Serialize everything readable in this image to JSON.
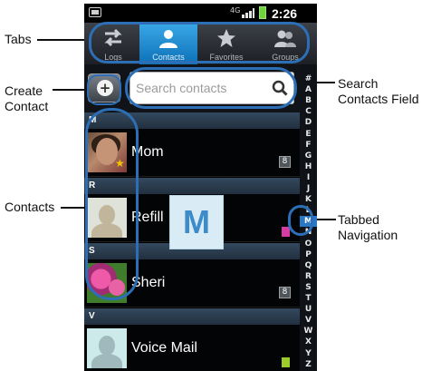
{
  "callouts": {
    "tabs": "Tabs",
    "create_contact": [
      "Create",
      "Contact"
    ],
    "search_field": [
      "Search",
      "Contacts Field"
    ],
    "contacts": "Contacts",
    "tabbed_nav": [
      "Tabbed",
      "Navigation"
    ]
  },
  "status_bar": {
    "network": "4G",
    "time": "2:26 PM"
  },
  "tabs": [
    {
      "label": "Logs",
      "icon": "logs-arrows-icon",
      "active": false
    },
    {
      "label": "Contacts",
      "icon": "contacts-person-icon",
      "active": true
    },
    {
      "label": "Favorites",
      "icon": "favorites-star-icon",
      "active": false
    },
    {
      "label": "Groups",
      "icon": "groups-people-icon",
      "active": false
    }
  ],
  "search": {
    "placeholder": "Search contacts",
    "add_icon": "add-contact-icon"
  },
  "contacts": {
    "sections": [
      "M",
      "R",
      "S",
      "V"
    ],
    "rows": [
      {
        "name": "Mom",
        "avatar": "mom-photo",
        "favorite": true,
        "badge": "8"
      },
      {
        "name": "Refill",
        "avatar": "default-person-icon",
        "favorite": false,
        "badge": ""
      },
      {
        "name": "Sheri",
        "avatar": "flower-photo",
        "favorite": false,
        "badge": "8"
      },
      {
        "name": "Voice Mail",
        "avatar": "default-person-icon",
        "favorite": false,
        "badge": ""
      }
    ]
  },
  "letter_popup": "M",
  "index": [
    "#",
    "A",
    "B",
    "C",
    "D",
    "E",
    "F",
    "G",
    "H",
    "I",
    "J",
    "K",
    "L",
    "M",
    "N",
    "O",
    "P",
    "Q",
    "R",
    "S",
    "T",
    "U",
    "V",
    "W",
    "X",
    "Y",
    "Z"
  ],
  "index_active": "M",
  "colors": {
    "accent": "#2c6fb6",
    "active_tab": "#1a8ad4",
    "section_header": "#2c3e50"
  }
}
